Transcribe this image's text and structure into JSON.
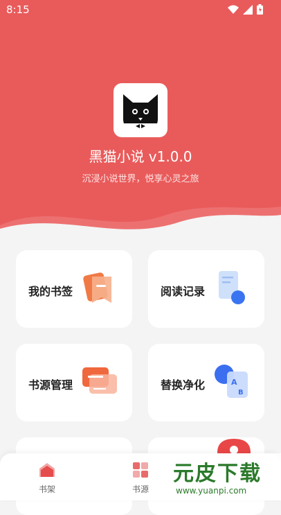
{
  "status": {
    "time": "8:15"
  },
  "app": {
    "title": "黑猫小说 v1.0.0",
    "subtitle": "沉浸小说世界，悦享心灵之旅"
  },
  "cards": [
    {
      "label": "我的书签",
      "icon": "bookmark-icon"
    },
    {
      "label": "阅读记录",
      "icon": "reading-history-icon"
    },
    {
      "label": "书源管理",
      "icon": "source-manage-icon"
    },
    {
      "label": "替换净化",
      "icon": "replace-purify-icon"
    }
  ],
  "tabs": [
    {
      "label": "书架",
      "icon": "bookshelf-icon"
    },
    {
      "label": "书源",
      "icon": "book-source-icon"
    }
  ],
  "watermark": {
    "cn": "元皮下载",
    "en": "www.yuanpi.com"
  },
  "colors": {
    "accent": "#e95b5b",
    "background": "#f4f4f4"
  }
}
